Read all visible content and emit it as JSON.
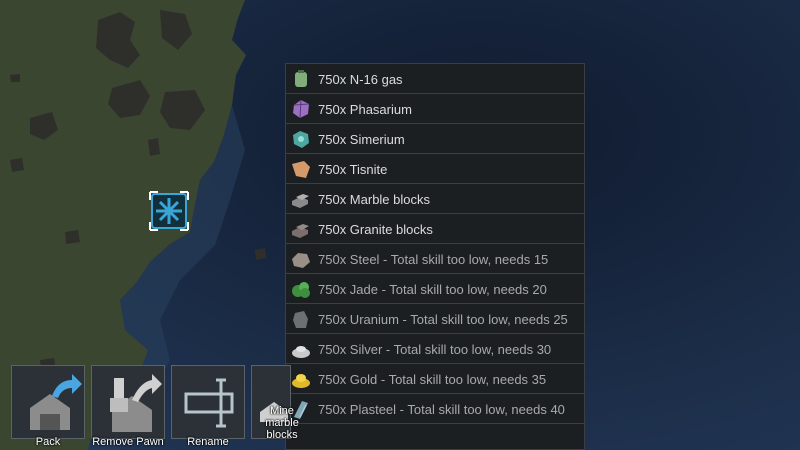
{
  "menu": {
    "options": [
      {
        "label": "750x N-16 gas",
        "icon": "gas-canister-icon",
        "color": "#7fae7a",
        "enabled": true
      },
      {
        "label": "750x Phasarium",
        "icon": "phasarium-crystal-icon",
        "color": "#9b6fc2",
        "enabled": true
      },
      {
        "label": "750x Simerium",
        "icon": "simerium-ore-icon",
        "color": "#4fa6a0",
        "enabled": true
      },
      {
        "label": "750x Tisnite",
        "icon": "tisnite-chunk-icon",
        "color": "#d59a6a",
        "enabled": true
      },
      {
        "label": "750x Marble blocks",
        "icon": "marble-blocks-icon",
        "color": "#8a8a8a",
        "enabled": true
      },
      {
        "label": "750x Granite blocks",
        "icon": "granite-blocks-icon",
        "color": "#7a6f6e",
        "enabled": true
      },
      {
        "label": "750x Steel - Total skill too low, needs 15",
        "icon": "steel-chunk-icon",
        "color": "#9a8f86",
        "enabled": false
      },
      {
        "label": "750x Jade - Total skill too low, needs 20",
        "icon": "jade-chunk-icon",
        "color": "#3e8f3e",
        "enabled": false
      },
      {
        "label": "750x Uranium - Total skill too low, needs 25",
        "icon": "uranium-chunk-icon",
        "color": "#6d7070",
        "enabled": false
      },
      {
        "label": "750x Silver - Total skill too low, needs 30",
        "icon": "silver-pile-icon",
        "color": "#c9c9c9",
        "enabled": false
      },
      {
        "label": "750x Gold - Total skill too low, needs 35",
        "icon": "gold-pile-icon",
        "color": "#e0b92a",
        "enabled": false
      },
      {
        "label": "750x Plasteel - Total skill too low, needs 40",
        "icon": "plasteel-bar-icon",
        "color": "#7fa7b6",
        "enabled": false
      }
    ]
  },
  "gizmos": [
    {
      "label": "Pack",
      "icon": "pack-icon"
    },
    {
      "label": "Remove Pawn",
      "icon": "remove-pawn-icon"
    },
    {
      "label": "Rename",
      "icon": "rename-icon"
    },
    {
      "label": "Mine marble blocks",
      "icon": "mine-marble-icon"
    }
  ],
  "colors": {
    "ocean": "#1a2a42",
    "land": "#3d4a30",
    "menu_bg": "#1c1f22",
    "selection": "#3aa6d8"
  }
}
